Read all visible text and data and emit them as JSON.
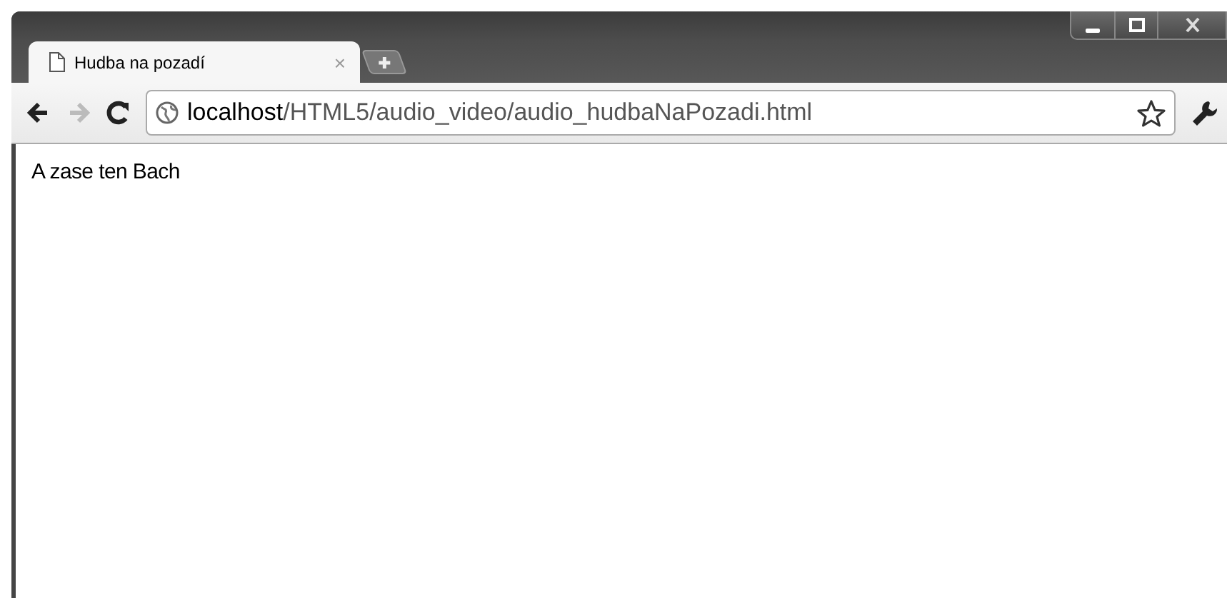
{
  "window": {
    "controls": [
      {
        "kind": "minimize"
      },
      {
        "kind": "maximize"
      },
      {
        "kind": "close"
      }
    ]
  },
  "tabs": [
    {
      "title": "Hudba na pozadí",
      "selected": true,
      "close": "×"
    }
  ],
  "toolbar": {
    "back_disabled": false,
    "forward_disabled": true,
    "url_host": "localhost",
    "url_path": "/HTML5/audio_video/audio_hudbaNaPozadi.html"
  },
  "page": {
    "text": "A zase ten Bach"
  }
}
